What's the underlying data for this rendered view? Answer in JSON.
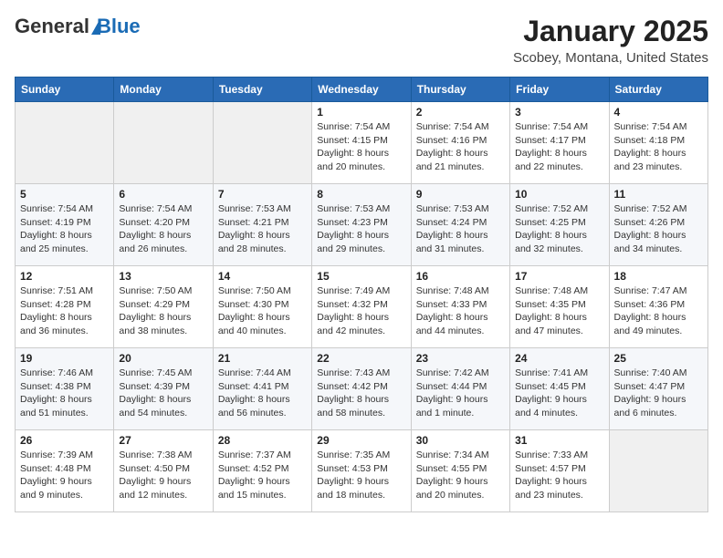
{
  "header": {
    "logo_general": "General",
    "logo_blue": "Blue",
    "month_title": "January 2025",
    "location": "Scobey, Montana, United States"
  },
  "days_of_week": [
    "Sunday",
    "Monday",
    "Tuesday",
    "Wednesday",
    "Thursday",
    "Friday",
    "Saturday"
  ],
  "weeks": [
    [
      {
        "day": "",
        "info": ""
      },
      {
        "day": "",
        "info": ""
      },
      {
        "day": "",
        "info": ""
      },
      {
        "day": "1",
        "info": "Sunrise: 7:54 AM\nSunset: 4:15 PM\nDaylight: 8 hours\nand 20 minutes."
      },
      {
        "day": "2",
        "info": "Sunrise: 7:54 AM\nSunset: 4:16 PM\nDaylight: 8 hours\nand 21 minutes."
      },
      {
        "day": "3",
        "info": "Sunrise: 7:54 AM\nSunset: 4:17 PM\nDaylight: 8 hours\nand 22 minutes."
      },
      {
        "day": "4",
        "info": "Sunrise: 7:54 AM\nSunset: 4:18 PM\nDaylight: 8 hours\nand 23 minutes."
      }
    ],
    [
      {
        "day": "5",
        "info": "Sunrise: 7:54 AM\nSunset: 4:19 PM\nDaylight: 8 hours\nand 25 minutes."
      },
      {
        "day": "6",
        "info": "Sunrise: 7:54 AM\nSunset: 4:20 PM\nDaylight: 8 hours\nand 26 minutes."
      },
      {
        "day": "7",
        "info": "Sunrise: 7:53 AM\nSunset: 4:21 PM\nDaylight: 8 hours\nand 28 minutes."
      },
      {
        "day": "8",
        "info": "Sunrise: 7:53 AM\nSunset: 4:23 PM\nDaylight: 8 hours\nand 29 minutes."
      },
      {
        "day": "9",
        "info": "Sunrise: 7:53 AM\nSunset: 4:24 PM\nDaylight: 8 hours\nand 31 minutes."
      },
      {
        "day": "10",
        "info": "Sunrise: 7:52 AM\nSunset: 4:25 PM\nDaylight: 8 hours\nand 32 minutes."
      },
      {
        "day": "11",
        "info": "Sunrise: 7:52 AM\nSunset: 4:26 PM\nDaylight: 8 hours\nand 34 minutes."
      }
    ],
    [
      {
        "day": "12",
        "info": "Sunrise: 7:51 AM\nSunset: 4:28 PM\nDaylight: 8 hours\nand 36 minutes."
      },
      {
        "day": "13",
        "info": "Sunrise: 7:50 AM\nSunset: 4:29 PM\nDaylight: 8 hours\nand 38 minutes."
      },
      {
        "day": "14",
        "info": "Sunrise: 7:50 AM\nSunset: 4:30 PM\nDaylight: 8 hours\nand 40 minutes."
      },
      {
        "day": "15",
        "info": "Sunrise: 7:49 AM\nSunset: 4:32 PM\nDaylight: 8 hours\nand 42 minutes."
      },
      {
        "day": "16",
        "info": "Sunrise: 7:48 AM\nSunset: 4:33 PM\nDaylight: 8 hours\nand 44 minutes."
      },
      {
        "day": "17",
        "info": "Sunrise: 7:48 AM\nSunset: 4:35 PM\nDaylight: 8 hours\nand 47 minutes."
      },
      {
        "day": "18",
        "info": "Sunrise: 7:47 AM\nSunset: 4:36 PM\nDaylight: 8 hours\nand 49 minutes."
      }
    ],
    [
      {
        "day": "19",
        "info": "Sunrise: 7:46 AM\nSunset: 4:38 PM\nDaylight: 8 hours\nand 51 minutes."
      },
      {
        "day": "20",
        "info": "Sunrise: 7:45 AM\nSunset: 4:39 PM\nDaylight: 8 hours\nand 54 minutes."
      },
      {
        "day": "21",
        "info": "Sunrise: 7:44 AM\nSunset: 4:41 PM\nDaylight: 8 hours\nand 56 minutes."
      },
      {
        "day": "22",
        "info": "Sunrise: 7:43 AM\nSunset: 4:42 PM\nDaylight: 8 hours\nand 58 minutes."
      },
      {
        "day": "23",
        "info": "Sunrise: 7:42 AM\nSunset: 4:44 PM\nDaylight: 9 hours\nand 1 minute."
      },
      {
        "day": "24",
        "info": "Sunrise: 7:41 AM\nSunset: 4:45 PM\nDaylight: 9 hours\nand 4 minutes."
      },
      {
        "day": "25",
        "info": "Sunrise: 7:40 AM\nSunset: 4:47 PM\nDaylight: 9 hours\nand 6 minutes."
      }
    ],
    [
      {
        "day": "26",
        "info": "Sunrise: 7:39 AM\nSunset: 4:48 PM\nDaylight: 9 hours\nand 9 minutes."
      },
      {
        "day": "27",
        "info": "Sunrise: 7:38 AM\nSunset: 4:50 PM\nDaylight: 9 hours\nand 12 minutes."
      },
      {
        "day": "28",
        "info": "Sunrise: 7:37 AM\nSunset: 4:52 PM\nDaylight: 9 hours\nand 15 minutes."
      },
      {
        "day": "29",
        "info": "Sunrise: 7:35 AM\nSunset: 4:53 PM\nDaylight: 9 hours\nand 18 minutes."
      },
      {
        "day": "30",
        "info": "Sunrise: 7:34 AM\nSunset: 4:55 PM\nDaylight: 9 hours\nand 20 minutes."
      },
      {
        "day": "31",
        "info": "Sunrise: 7:33 AM\nSunset: 4:57 PM\nDaylight: 9 hours\nand 23 minutes."
      },
      {
        "day": "",
        "info": ""
      }
    ]
  ]
}
